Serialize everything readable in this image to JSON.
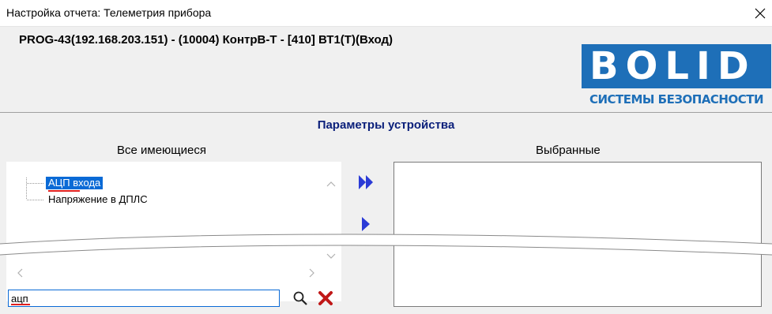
{
  "window": {
    "title": "Настройка отчета: Телеметрия прибора"
  },
  "device": {
    "description": "PROG-43(192.168.203.151) - (10004) КонтрВ-Т - [410] ВТ1(Т)(Вход)"
  },
  "logo": {
    "letters": "BOLID",
    "subtitle": "СИСТЕМЫ БЕЗОПАСНОСТИ",
    "color": "#1e6fb8"
  },
  "section": {
    "title": "Параметры устройства"
  },
  "available": {
    "header": "Все имеющиеся",
    "items": [
      {
        "label": "АЦП входа",
        "selected": true
      },
      {
        "label": "Напряжение в ДПЛС",
        "selected": false
      }
    ]
  },
  "selected": {
    "header": "Выбранные"
  },
  "search": {
    "value": "ацп"
  },
  "icons": {
    "close": "close-icon",
    "add_all": "double-arrow-right-icon",
    "add": "arrow-right-icon",
    "search": "magnifier-icon",
    "clear": "red-cross-icon"
  },
  "colors": {
    "accent": "#0a6ad6",
    "arrow": "#2b3bd6",
    "section_title": "#0a1f7a"
  }
}
